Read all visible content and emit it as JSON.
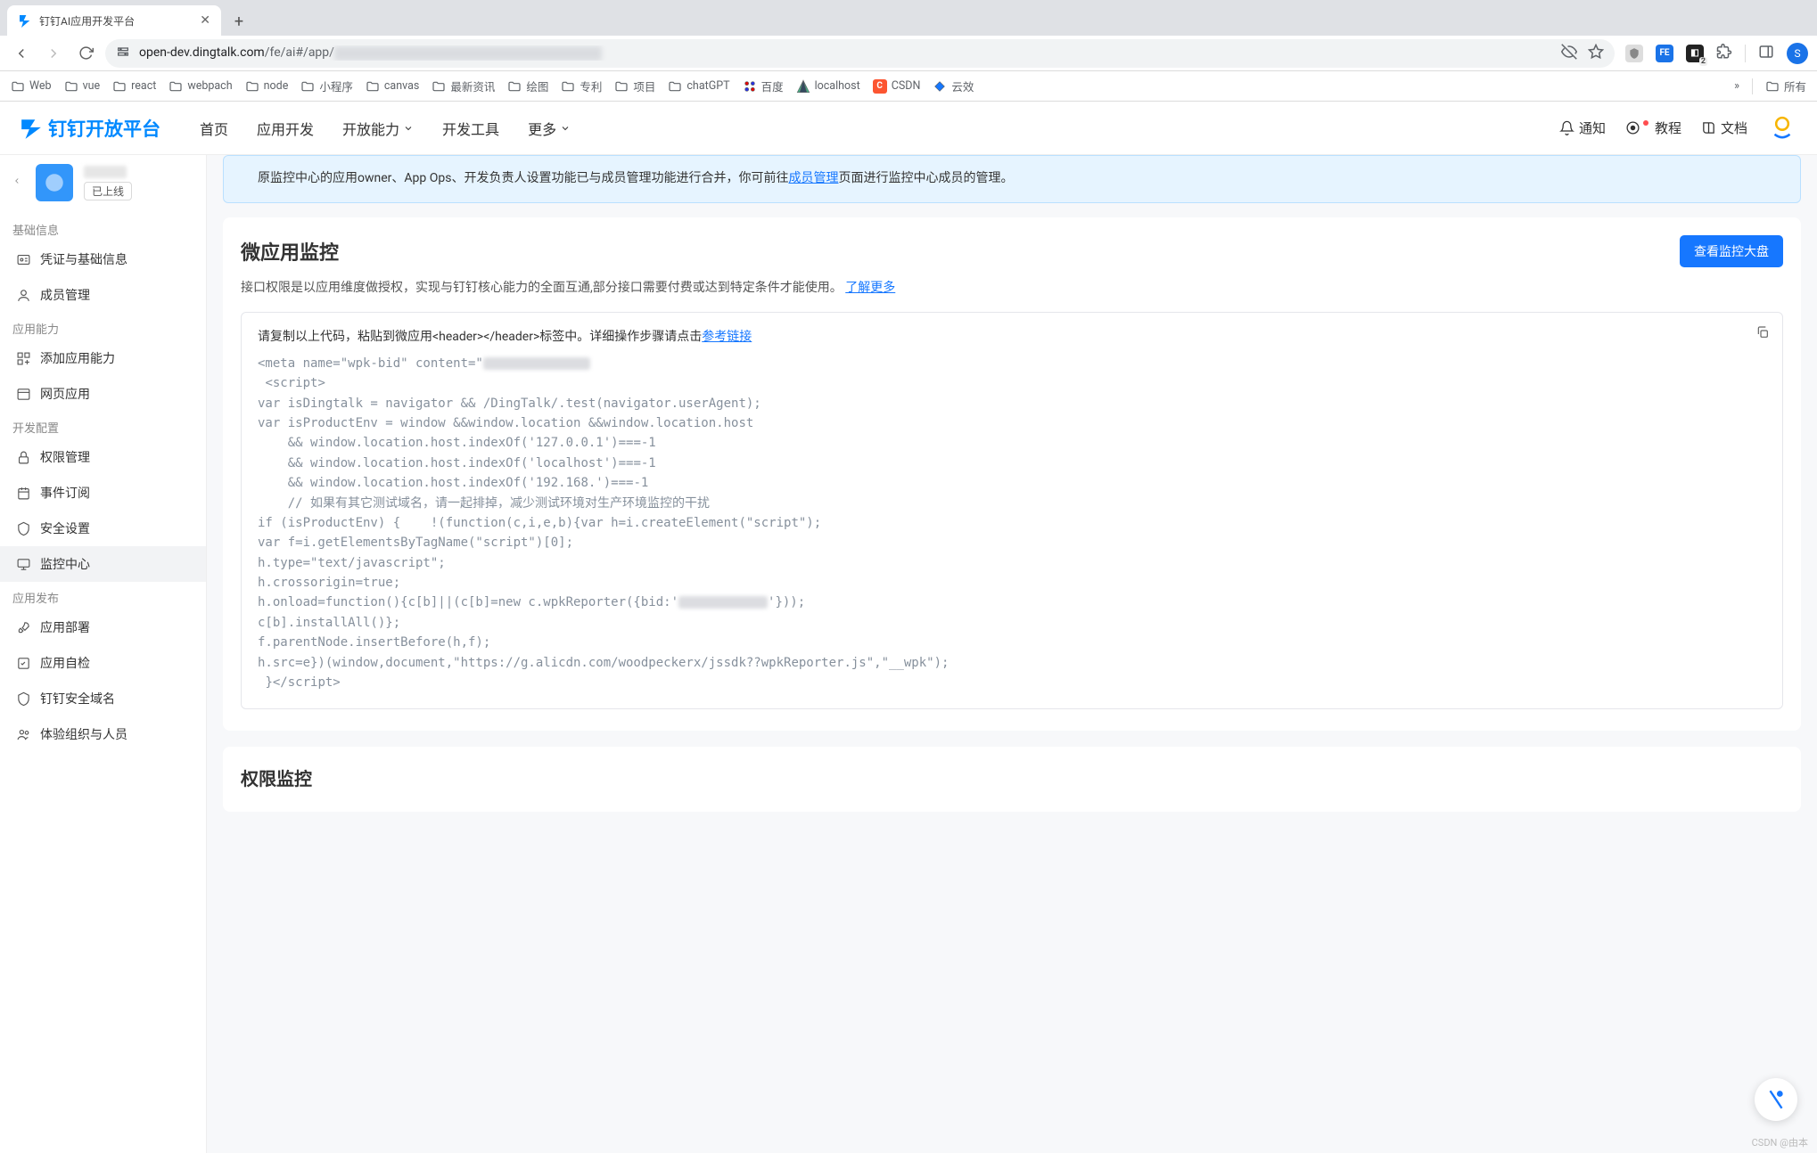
{
  "browser": {
    "tab_title": "钉钉AI应用开发平台",
    "url_domain": "open-dev.dingtalk.com",
    "url_path": "/fe/ai#/app/",
    "avatar_letter": "S",
    "bookmarks": [
      "Web",
      "vue",
      "react",
      "webpach",
      "node",
      "小程序",
      "canvas",
      "最新资讯",
      "绘图",
      "专利",
      "项目",
      "chatGPT",
      "百度",
      "localhost",
      "CSDN",
      "云效"
    ],
    "bookmarks_overflow": "所有"
  },
  "appnav": {
    "brand": "钉钉开放平台",
    "links": [
      "首页",
      "应用开发",
      "开放能力",
      "开发工具",
      "更多"
    ],
    "dropdown_indexes": [
      2,
      4
    ],
    "right": {
      "notify": "通知",
      "tutorial": "教程",
      "docs": "文档"
    }
  },
  "sidebar": {
    "status": "已上线",
    "groups": [
      {
        "title": "基础信息",
        "items": [
          {
            "id": "credentials",
            "label": "凭证与基础信息",
            "icon": "id-card"
          },
          {
            "id": "members",
            "label": "成员管理",
            "icon": "user"
          }
        ]
      },
      {
        "title": "应用能力",
        "items": [
          {
            "id": "add-capability",
            "label": "添加应用能力",
            "icon": "grid-plus"
          },
          {
            "id": "web-app",
            "label": "网页应用",
            "icon": "browser"
          }
        ]
      },
      {
        "title": "开发配置",
        "items": [
          {
            "id": "permissions",
            "label": "权限管理",
            "icon": "lock"
          },
          {
            "id": "events",
            "label": "事件订阅",
            "icon": "calendar"
          },
          {
            "id": "security",
            "label": "安全设置",
            "icon": "shield"
          },
          {
            "id": "monitor",
            "label": "监控中心",
            "icon": "monitor",
            "active": true
          }
        ]
      },
      {
        "title": "应用发布",
        "items": [
          {
            "id": "deploy",
            "label": "应用部署",
            "icon": "rocket"
          },
          {
            "id": "selfcheck",
            "label": "应用自检",
            "icon": "checklist"
          },
          {
            "id": "safedomain",
            "label": "钉钉安全域名",
            "icon": "shield"
          },
          {
            "id": "experience",
            "label": "体验组织与人员",
            "icon": "users"
          }
        ]
      }
    ]
  },
  "alert": {
    "text_prefix": "原监控中心的应用owner、App Ops、开发负责人设置功能已与成员管理功能进行合并，你可前往",
    "link": "成员管理",
    "text_suffix": "页面进行监控中心成员的管理。"
  },
  "card": {
    "title": "微应用监控",
    "button": "查看监控大盘",
    "subtitle_prefix": "接口权限是以应用维度做授权，实现与钉钉核心能力的全面互通,部分接口需要付费或达到特定条件才能使用。",
    "subtitle_link": "了解更多",
    "code_instruction_prefix": "请复制以上代码，粘贴到微应用<header></header>标签中。详细操作步骤请点击",
    "code_instruction_link": "参考链接",
    "code_lines": [
      "<meta name=\"wpk-bid\" content=\"[SMUDGE:120]",
      " <script>",
      "var isDingtalk = navigator && /DingTalk/.test(navigator.userAgent);",
      "var isProductEnv = window &&window.location &&window.location.host",
      "    && window.location.host.indexOf('127.0.0.1')===-1",
      "    && window.location.host.indexOf('localhost')===-1",
      "    && window.location.host.indexOf('192.168.')===-1",
      "    // 如果有其它测试域名，请一起排掉，减少测试环境对生产环境监控的干扰",
      "if (isProductEnv) {    !(function(c,i,e,b){var h=i.createElement(\"script\");",
      "var f=i.getElementsByTagName(\"script\")[0];",
      "h.type=\"text/javascript\";",
      "h.crossorigin=true;",
      "h.onload=function(){c[b]||(c[b]=new c.wpkReporter({bid:'[SMUDGE:100]'}));",
      "c[b].installAll()};",
      "f.parentNode.insertBefore(h,f);",
      "h.src=e})(window,document,\"https://g.alicdn.com/woodpeckerx/jssdk??wpkReporter.js\",\"__wpk\");",
      " }</script>"
    ]
  },
  "second_card_title": "权限监控",
  "watermark": "CSDN @由本"
}
